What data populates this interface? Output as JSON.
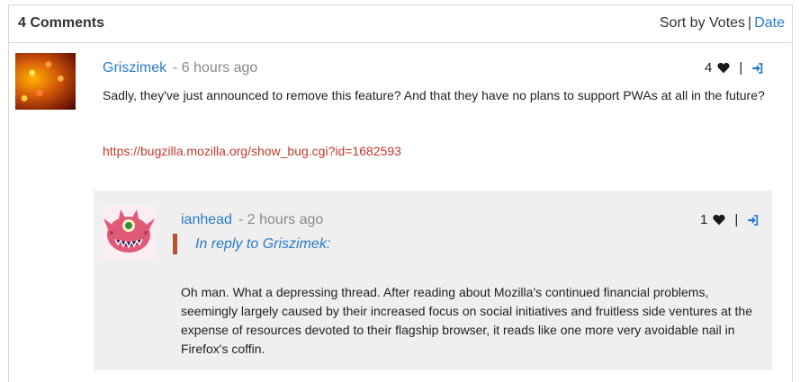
{
  "header": {
    "count_label": "4 Comments",
    "sort_prefix": "Sort by",
    "sort_votes": "Votes",
    "sort_separator": "|",
    "sort_date": "Date"
  },
  "comments": [
    {
      "author": "Griszimek",
      "time": "- 6 hours ago",
      "votes": "4",
      "text": "Sadly, they've just announced to remove this feature? And that they have no plans to support PWAs at all in the future?",
      "link": "https://bugzilla.mozilla.org/show_bug.cgi?id=1682593"
    }
  ],
  "reply": {
    "author": "ianhead",
    "time": "- 2 hours ago",
    "votes": "1",
    "in_reply_to": "In reply to Griszimek:",
    "text": "Oh man. What a depressing thread. After reading about Mozilla's continued financial problems, seemingly largely caused by their increased focus on social initiatives and fruitless side ventures at the expense of resources devoted to their flagship browser, it reads like one more very avoidable nail in Firefox's coffin."
  },
  "icons": {
    "vote": "heart-icon",
    "permalink": "sign-in-icon"
  },
  "colors": {
    "link_blue": "#2a7ac9",
    "url_red": "#c0392b",
    "quote_bar": "#b5532e",
    "reply_bg": "#efefef"
  }
}
